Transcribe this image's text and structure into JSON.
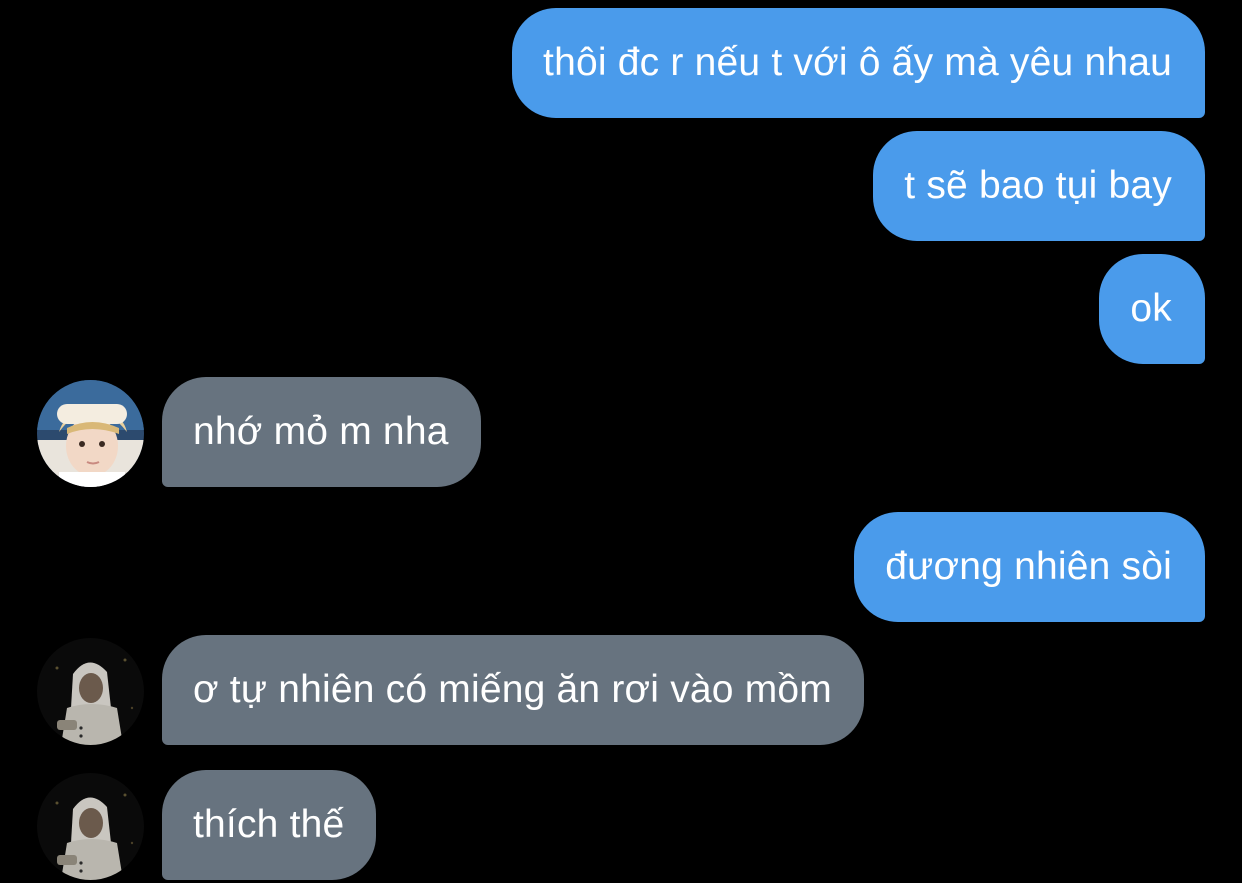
{
  "messages": [
    {
      "direction": "outgoing",
      "text": "thôi đc r nếu t với ô ấy mà yêu nhau"
    },
    {
      "direction": "outgoing",
      "text": "t sẽ bao tụi bay"
    },
    {
      "direction": "outgoing",
      "text": "ok"
    },
    {
      "direction": "incoming",
      "text": "nhớ mỏ m nha",
      "avatar": "avatar-blond-boy"
    },
    {
      "direction": "outgoing",
      "text": "đương nhiên sòi"
    },
    {
      "direction": "incoming",
      "text": "ơ tự nhiên có miếng ăn rơi vào mồm",
      "avatar": "avatar-hooded-person"
    },
    {
      "direction": "incoming",
      "text": "thích thế",
      "avatar": "avatar-hooded-person"
    }
  ],
  "colors": {
    "background": "#000000",
    "outgoing_bubble": "#4a9beb",
    "incoming_bubble": "#67737f",
    "text": "#ffffff"
  }
}
